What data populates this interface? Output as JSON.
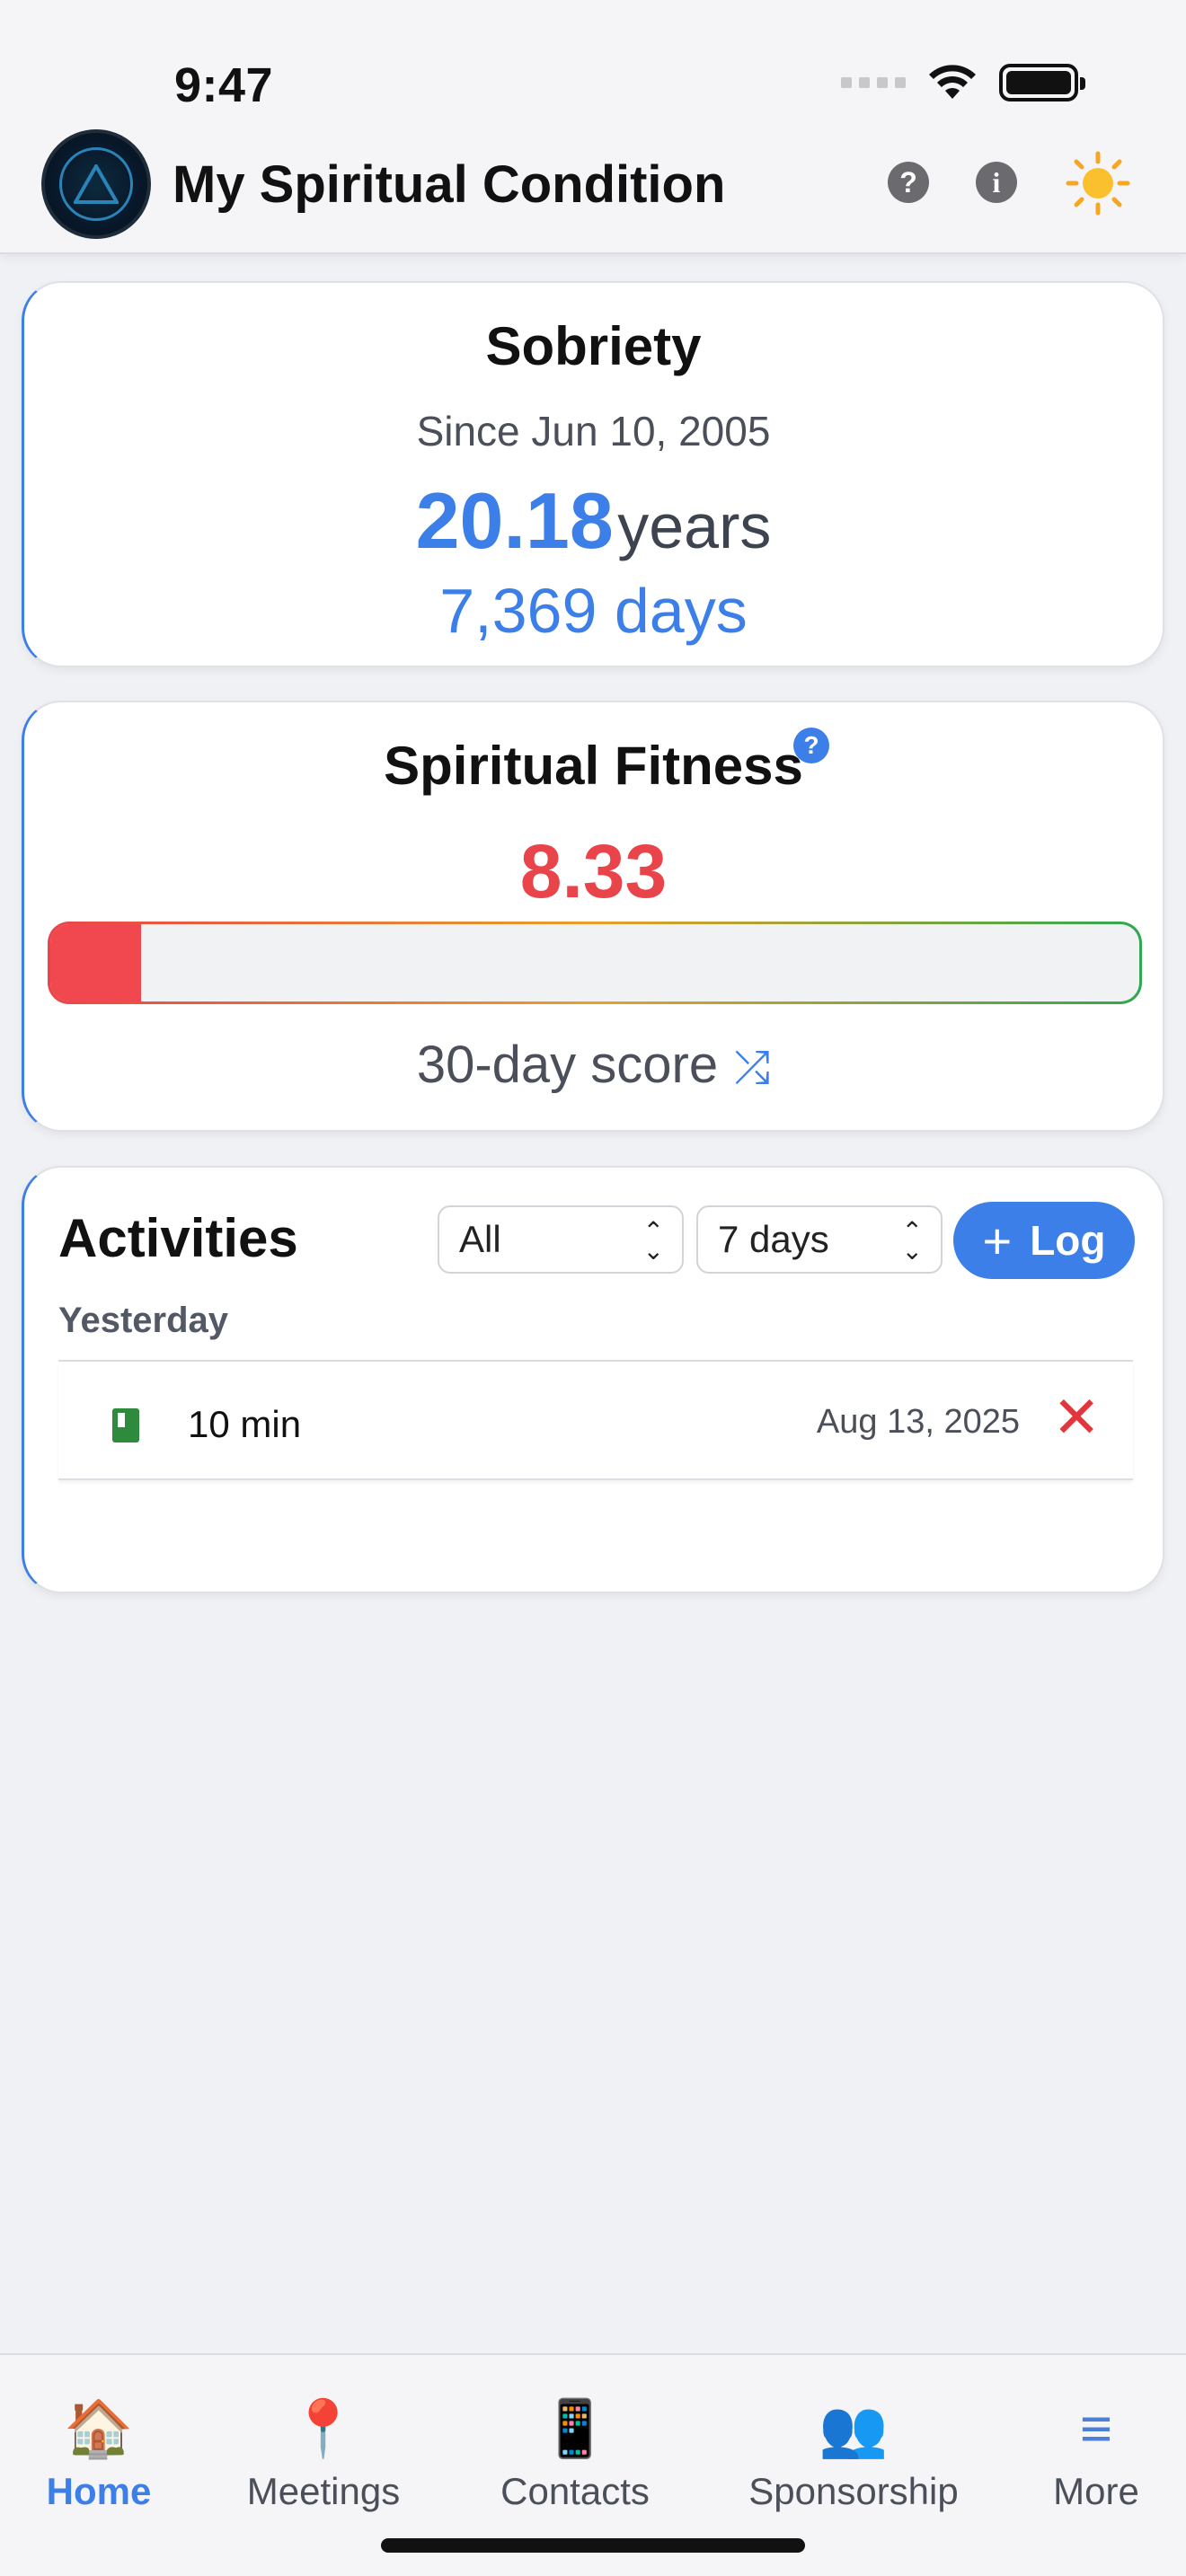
{
  "status_bar": {
    "time": "9:47"
  },
  "header": {
    "title": "My Spiritual Condition"
  },
  "sobriety": {
    "title": "Sobriety",
    "since": "Since Jun 10, 2005",
    "years_value": "20.18",
    "years_unit": "years",
    "days": "7,369 days"
  },
  "fitness": {
    "title": "Spiritual Fitness",
    "score": "8.33",
    "score_fraction": 0.0833,
    "footer": "30-day score"
  },
  "activities": {
    "title": "Activities",
    "filter_type": "All",
    "filter_range": "7 days",
    "log_label": "Log",
    "group_label": "Yesterday",
    "items": [
      {
        "icon": "book-icon",
        "duration": "10 min",
        "date": "Aug 13, 2025"
      }
    ]
  },
  "tabs": [
    {
      "label": "Home",
      "icon": "house-icon",
      "active": true
    },
    {
      "label": "Meetings",
      "icon": "pin-icon"
    },
    {
      "label": "Contacts",
      "icon": "phone-icon"
    },
    {
      "label": "Sponsorship",
      "icon": "people-icon"
    },
    {
      "label": "More",
      "icon": "menu-icon"
    }
  ],
  "colors": {
    "accent": "#3d7fe8",
    "danger": "#e8444a",
    "success": "#2fa84f"
  }
}
